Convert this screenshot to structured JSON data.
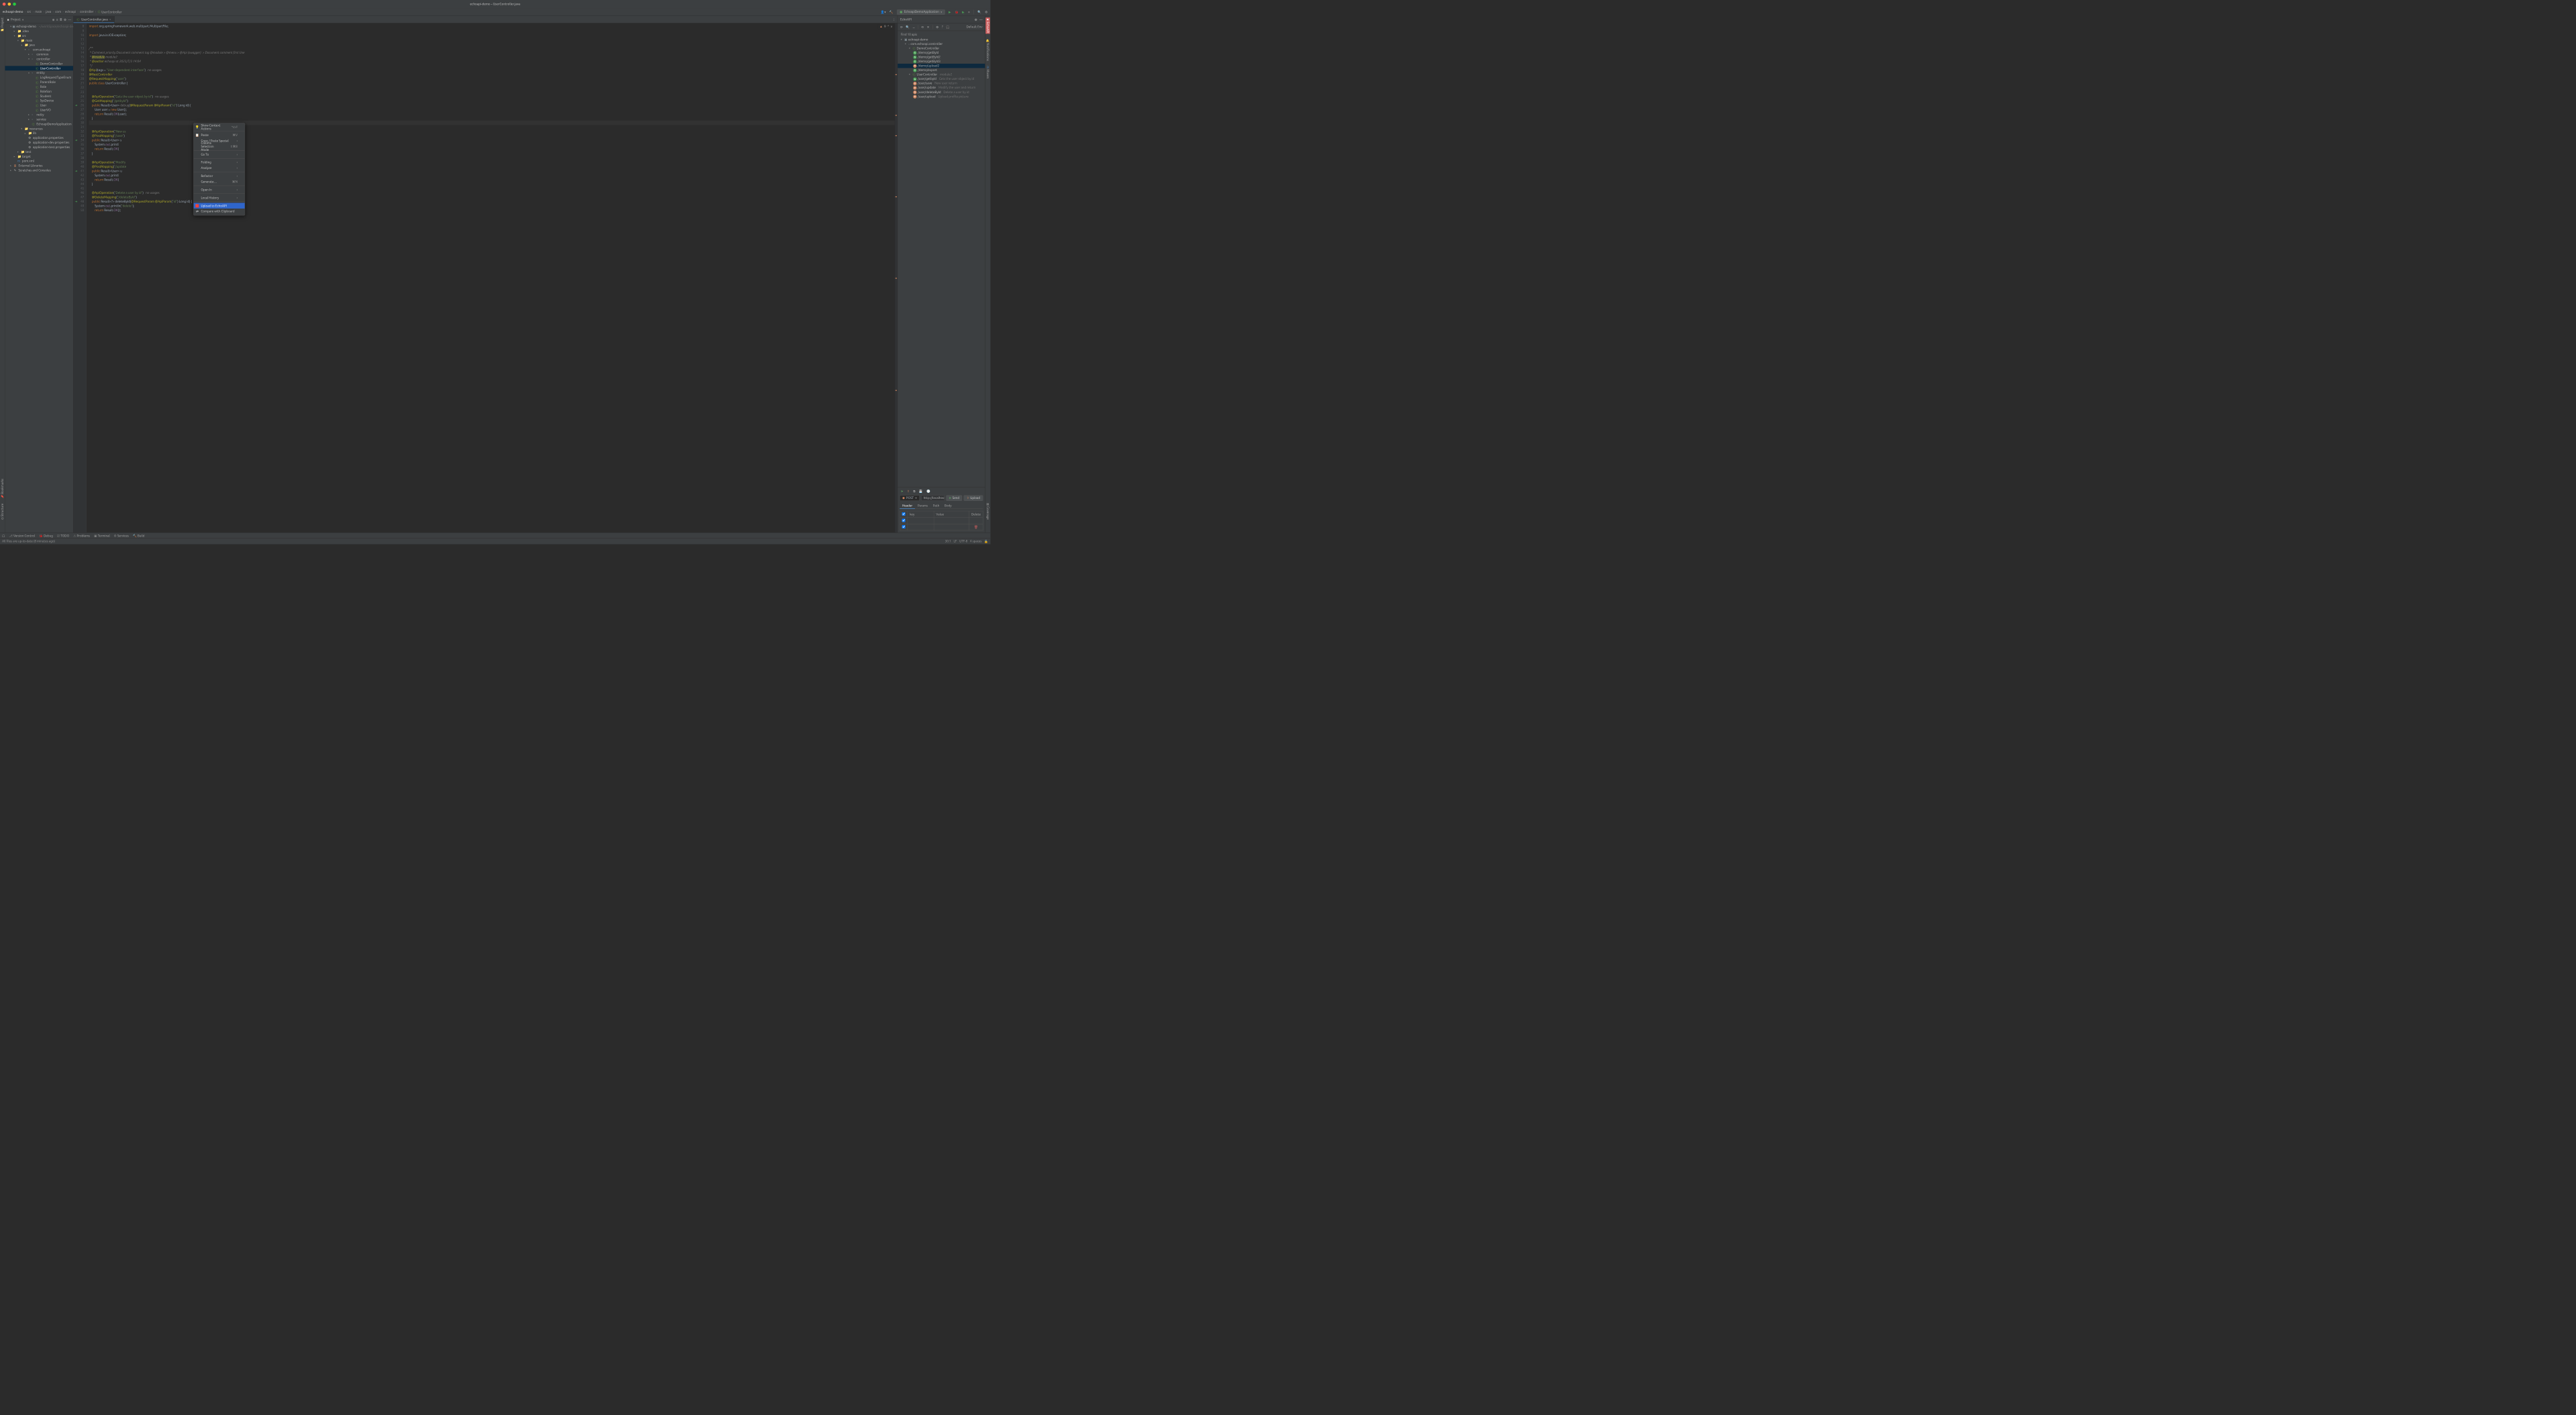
{
  "window_title": "echoapi-demo – UserController.java",
  "breadcrumbs": [
    "echoapi-demo",
    "src",
    "main",
    "java",
    "com",
    "echoapi",
    "controller",
    "UserController"
  ],
  "run_config": "EchoapiDemoApplication",
  "project_header": "Project",
  "filetree": {
    "root": "echoapi-demo",
    "root_path": "~/workSpace/echoapi-demo",
    "nodes": [
      {
        "d": 1,
        "c": "▾",
        "i": "mod",
        "t": "echoapi-demo",
        "extra": "~/workSpace/echoapi-demo"
      },
      {
        "d": 2,
        "c": "▸",
        "i": "dir",
        "t": ".idea"
      },
      {
        "d": 2,
        "c": "▾",
        "i": "dir",
        "t": "src"
      },
      {
        "d": 3,
        "c": "▾",
        "i": "dir",
        "t": "main"
      },
      {
        "d": 4,
        "c": "▾",
        "i": "srcdir",
        "t": "java"
      },
      {
        "d": 5,
        "c": "▾",
        "i": "pkg",
        "t": "com.echoapi"
      },
      {
        "d": 6,
        "c": "▸",
        "i": "pkg",
        "t": "common"
      },
      {
        "d": 6,
        "c": "▾",
        "i": "pkg",
        "t": "controller"
      },
      {
        "d": 7,
        "c": "",
        "i": "cls",
        "t": "DemoController"
      },
      {
        "d": 7,
        "c": "",
        "i": "cls",
        "t": "UserController",
        "sel": true
      },
      {
        "d": 6,
        "c": "▾",
        "i": "pkg",
        "t": "entity"
      },
      {
        "d": 7,
        "c": "",
        "i": "cls",
        "t": "LogRequestTypeEnum"
      },
      {
        "d": 7,
        "c": "",
        "i": "cls",
        "t": "ParentRole"
      },
      {
        "d": 7,
        "c": "",
        "i": "cls",
        "t": "Role"
      },
      {
        "d": 7,
        "c": "",
        "i": "cls",
        "t": "RoleSon"
      },
      {
        "d": 7,
        "c": "",
        "i": "cls",
        "t": "Student"
      },
      {
        "d": 7,
        "c": "",
        "i": "cls",
        "t": "SysDevice"
      },
      {
        "d": 7,
        "c": "",
        "i": "cls",
        "t": "User"
      },
      {
        "d": 7,
        "c": "",
        "i": "cls",
        "t": "UserVO"
      },
      {
        "d": 6,
        "c": "▸",
        "i": "pkg",
        "t": "netty"
      },
      {
        "d": 6,
        "c": "▸",
        "i": "pkg",
        "t": "service"
      },
      {
        "d": 6,
        "c": "",
        "i": "cls",
        "t": "EchoapiDemoApplication"
      },
      {
        "d": 4,
        "c": "▾",
        "i": "resdir",
        "t": "resources"
      },
      {
        "d": 5,
        "c": "▸",
        "i": "dir",
        "t": "lib"
      },
      {
        "d": 5,
        "c": "",
        "i": "prop",
        "t": "application.properties"
      },
      {
        "d": 5,
        "c": "",
        "i": "prop",
        "t": "application-dev.properties"
      },
      {
        "d": 5,
        "c": "",
        "i": "prop",
        "t": "application-test.properties"
      },
      {
        "d": 3,
        "c": "▸",
        "i": "dir",
        "t": "test"
      },
      {
        "d": 2,
        "c": "▸",
        "i": "tgtdir",
        "t": "target"
      },
      {
        "d": 2,
        "c": "",
        "i": "mvn",
        "t": "pom.xml"
      },
      {
        "d": 1,
        "c": "▸",
        "i": "lib",
        "t": "External Libraries"
      },
      {
        "d": 1,
        "c": "▸",
        "i": "scr",
        "t": "Scratches and Consoles"
      }
    ]
  },
  "tab": {
    "name": "UserController.java"
  },
  "issues": {
    "warn": "9",
    "up": "^",
    "down": "v"
  },
  "code_start": 8,
  "code": [
    "<span class='kc'>import</span> org.springframework.web.multipart.MultipartFile;",
    "",
    "<span class='kc'>import</span> java.io.IOException;",
    "",
    "",
    "<span class='kcmt'>/**</span>",
    "<span class='kcmt'> * Comment priority:Document comment tag @module &gt; @menu &gt; @Api (swagger)  &gt; Document comment first line</span>",
    "<span class='kcmt'> * <span class='ka' style='background:#45493b'>@module</span> module2</span>",
    "<span class='kcmt'> * <span class='ka'>@author</span> echoapi at 2023/7/3 14:04</span>",
    "<span class='kcmt'> */</span>",
    "<span class='ka'>@Api</span>(tags = <span class='ks'>\"User-dependent interface\"</span>)   <span class='kd'>no usages</span>",
    "<span class='ka'>@RestController</span>",
    "<span class='ka'>@RequestMapping</span>(<span class='ks'>\"user\"</span>)",
    "<span class='kc'>public class</span> UserController {",
    "",
    "",
    "    <span class='ka'>@ApiOperation</span>(<span class='ks'>\"Gets the user object by id\"</span>)   <span class='kd'>no usages</span>",
    "    <span class='ka'>@GetMapping</span>(<span class='ks'>\"/getbyId\"</span>)",
    "    <span class='kc'>public</span> Result&lt;User&gt; <span class='kd'>debug</span>(<span class='ka'>@RequestParam</span> <span class='ka'>@ApiParam</span>(<span class='ks'>\"id\"</span>) Long id) {",
    "        User user = <span class='kc'>new</span> User();",
    "        <span class='kc'>return</span> Result.<span class='kv'>OK</span>(user);",
    "    }",
    "",
    "",
    "    <span class='ka'>@ApiOperation</span>(<span class='ks'>\"New us</span>",
    "    <span class='ka'>@PostMapping</span>(<span class='ks'>\"/save\"</span>)",
    "    <span class='kc'>public</span> Result&lt;User&gt; s",
    "        System.<span class='kv'>out</span>.printl",
    "        <span class='kc'>return</span> Result.<span class='kv'>OK</span>(",
    "    }",
    "",
    "    <span class='ka'>@ApiOperation</span>(<span class='ks'>\"Modify</span>",
    "    <span class='ka'>@PostMapping</span>(<span class='ks'>\"/update</span>",
    "    <span class='kc'>public</span> Result&lt;User&gt; u",
    "        System.<span class='kv'>out</span>.printl",
    "        <span class='kc'>return</span> Result.<span class='kv'>OK</span>(",
    "    }",
    "",
    "    <span class='ka'>@ApiOperation</span>(<span class='ks'>\"Delete a user by id\"</span>)   <span class='kd'>no usages</span>",
    "    <span class='ka'>@DeleteMapping</span>(<span class='ks'>\"/deleteById\"</span>)",
    "    <span class='kc'>public</span> Result&lt;?&gt; deleteById(<span class='ka'>@RequestParam</span> <span class='ka'>@ApiParam</span>(<span class='ks'>\"id\"</span>) Long id) {",
    "        System.<span class='kv'>out</span>.println(<span class='ks'>\"delete\"</span>);",
    "        <span class='kc'>return</span> Result.<span class='kv'>OK</span>();"
  ],
  "arrows": [
    26,
    34,
    41,
    48
  ],
  "context_menu": [
    {
      "type": "item",
      "icon": "💡",
      "label": "Show Context Actions",
      "shortcut": "⌥⏎"
    },
    {
      "type": "sep"
    },
    {
      "type": "item",
      "icon": "📋",
      "label": "Paste",
      "shortcut": "⌘V"
    },
    {
      "type": "item",
      "label": "Copy / Paste Special",
      "sub": true
    },
    {
      "type": "item",
      "label": "Column Selection Mode",
      "shortcut": "⇧⌘8"
    },
    {
      "type": "sep"
    },
    {
      "type": "item",
      "label": "Go To",
      "sub": true
    },
    {
      "type": "sep"
    },
    {
      "type": "item",
      "label": "Folding",
      "sub": true
    },
    {
      "type": "item",
      "label": "Analyze",
      "sub": true
    },
    {
      "type": "sep"
    },
    {
      "type": "item",
      "label": "Refactor",
      "sub": true
    },
    {
      "type": "item",
      "label": "Generate…",
      "shortcut": "⌘N"
    },
    {
      "type": "sep"
    },
    {
      "type": "item",
      "label": "Open In",
      "sub": true
    },
    {
      "type": "sep"
    },
    {
      "type": "item",
      "label": "Local History",
      "sub": true
    },
    {
      "type": "sep"
    },
    {
      "type": "item",
      "icon": "🟥",
      "label": "Upload to EchoAPI",
      "hl": true
    },
    {
      "type": "item",
      "icon": "⇄",
      "label": "Compare with Clipboard"
    }
  ],
  "echoapi": {
    "title": "EchoAPI",
    "default_env": "Default Env",
    "find_text": "Find 10 apis",
    "tree": [
      {
        "d": 0,
        "c": "▾",
        "i": "root",
        "t": "echoapi-demo"
      },
      {
        "d": 1,
        "c": "▾",
        "i": "pkg",
        "t": "com.echoapi.controller"
      },
      {
        "d": 2,
        "c": "▾",
        "i": "cls",
        "t": "DemoController"
      },
      {
        "d": 3,
        "m": "G",
        "mc": "mget",
        "t": "/demo/getById"
      },
      {
        "d": 3,
        "m": "G",
        "mc": "mget",
        "t": "/demo/getById2"
      },
      {
        "d": 3,
        "m": "G",
        "mc": "mget",
        "t": "/demo/getById3"
      },
      {
        "d": 3,
        "m": "P",
        "mc": "mpost",
        "t": "/demo/upload2",
        "sel": true
      },
      {
        "d": 3,
        "m": "G",
        "mc": "mget",
        "t": "/demo/export"
      },
      {
        "d": 2,
        "c": "▾",
        "i": "cls",
        "t": "UserController",
        "extra": "module2"
      },
      {
        "d": 3,
        "m": "G",
        "mc": "mget",
        "t": "/user/getbyId",
        "extra": "Gets the user object by id"
      },
      {
        "d": 3,
        "m": "P",
        "mc": "mpost",
        "t": "/user/save",
        "extra": "New user return"
      },
      {
        "d": 3,
        "m": "P",
        "mc": "mpost",
        "t": "/user/update",
        "extra": "Modify the user and return"
      },
      {
        "d": 3,
        "m": "D",
        "mc": "mpost",
        "t": "/user/deleteById",
        "extra": "Delete a user by id"
      },
      {
        "d": 3,
        "m": "P",
        "mc": "mpost",
        "t": "/user/upload",
        "extra": "Upload profile picture"
      }
    ],
    "method": "POST",
    "url": "http://localhost:8083/",
    "send": "Send",
    "upload": "Upload",
    "tabs": [
      "Header",
      "Params",
      "Path",
      "Body"
    ],
    "table": {
      "h": [
        "",
        "key",
        "Value",
        "Delete"
      ]
    }
  },
  "bottom_tools": [
    "Version Control",
    "Debug",
    "TODO",
    "Problems",
    "Terminal",
    "Services",
    "Build"
  ],
  "status_msg": "All files are up-to-date (8 minutes ago)",
  "status_right": [
    "30:1",
    "LF",
    "UTF-8",
    "4 spaces"
  ],
  "rails": {
    "left": [
      "Project",
      "Bookmarks",
      "Structure"
    ],
    "right": [
      "EchoAPI",
      "Notifications",
      "Maven",
      "Coverage"
    ]
  }
}
